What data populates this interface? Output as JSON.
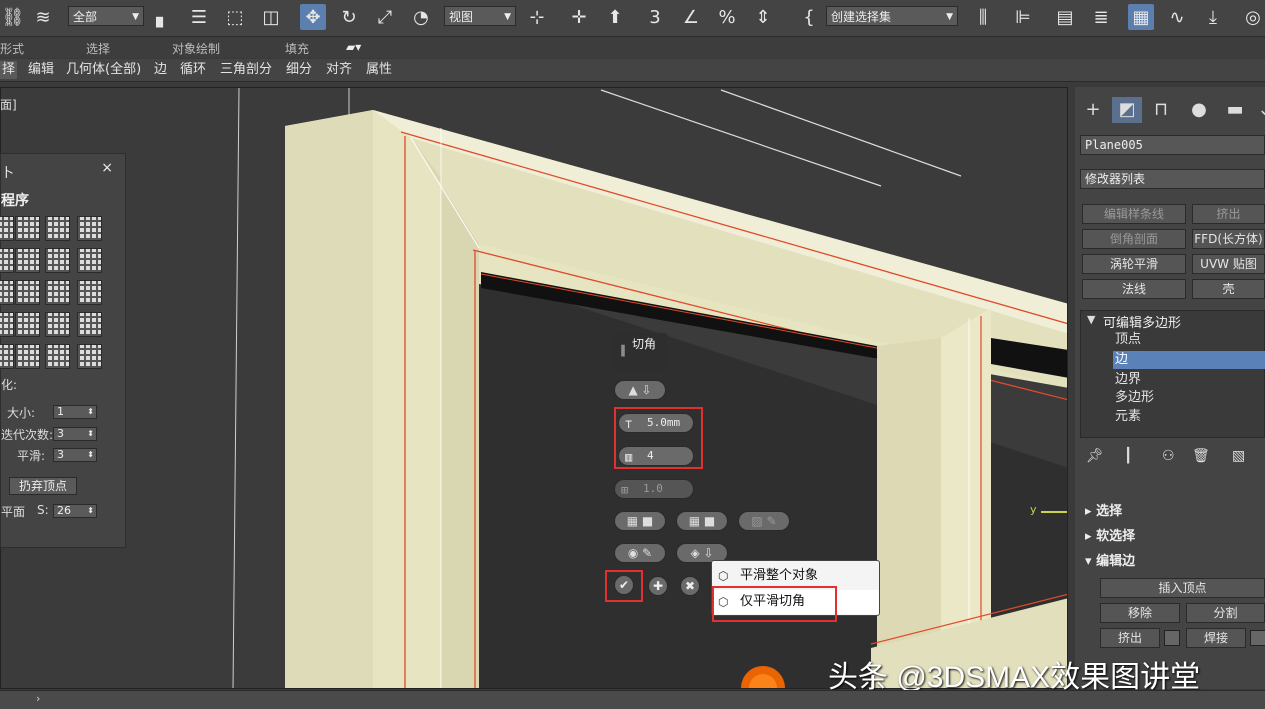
{
  "toolbar": {
    "selection_filter": "全部",
    "ref_coord": "视图",
    "named_selection": "创建选择集"
  },
  "ribbon": {
    "groups": [
      "形式",
      "选择",
      "对象绘制",
      "填充"
    ],
    "tabs": [
      "择",
      "编辑",
      "几何体(全部)",
      "边",
      "循环",
      "三角剖分",
      "细分",
      "对齐",
      "属性"
    ]
  },
  "viewport": {
    "label": "面]",
    "axis_y": "y"
  },
  "left_panel": {
    "title": "​卜",
    "close": "×",
    "section": "程序",
    "subsection": "化:",
    "size_label": "大小:",
    "size_value": "1",
    "iter_label": "迭代次数:",
    "iter_value": "3",
    "smooth_label": "平滑:",
    "smooth_value": "3",
    "discard_button": "扔弃顶点",
    "plane_label": "平面",
    "s_label": "S:",
    "s_value": "26"
  },
  "caddy": {
    "title": "切角",
    "amount": "5.0mm",
    "segments": "4",
    "tension": "1.0"
  },
  "popup_menu": {
    "items": [
      "平滑整个对象",
      "仅平滑切角"
    ]
  },
  "command_panel": {
    "object_name": "Plane005",
    "modifier_list": "修改器列表",
    "buttons": [
      "编辑样条线",
      "挤出",
      "倒角剖面",
      "FFD(长方体)",
      "涡轮平滑",
      "UVW 贴图",
      "法线",
      "壳"
    ],
    "stack_root": "可编辑多边形",
    "stack_items": [
      "顶点",
      "边",
      "边界",
      "多边形",
      "元素"
    ],
    "rollouts": [
      "选择",
      "软选择",
      "编辑边"
    ],
    "edit_edge_buttons": {
      "insert_vertex": "插入顶点",
      "remove": "移除",
      "split": "分割",
      "extrude": "挤出",
      "weld": "焊接"
    }
  },
  "watermark": "头条 @3DSMAX效果图讲堂",
  "colors": {
    "accent": "#5b82b8",
    "highlight_box": "#e03030",
    "frame": "#e9e6c4",
    "edge": "#e04a2a",
    "cursor_glow": "#ff6a00"
  }
}
